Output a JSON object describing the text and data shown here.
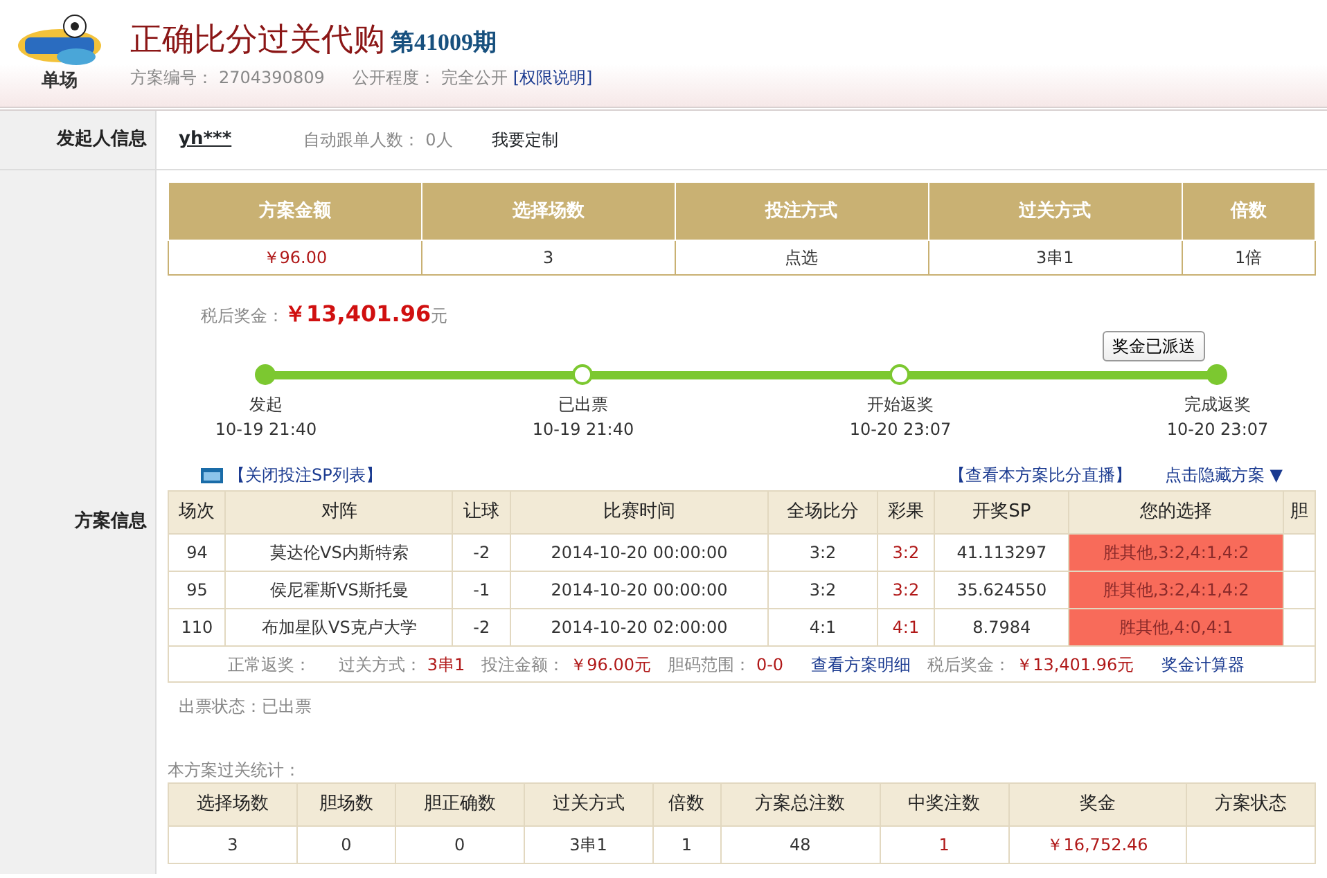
{
  "header": {
    "logo_caption": "单场",
    "title": "正确比分过关代购",
    "issue": "第41009期",
    "plan_no_label": "方案编号：",
    "plan_no": "2704390809",
    "public_label": "公开程度：",
    "public_value": "完全公开",
    "permission_link": "[权限说明]"
  },
  "initiator": {
    "label": "发起人信息",
    "user": "yh***",
    "follow_label": "自动跟单人数：",
    "follow_value": "0人",
    "custom_link": "我要定制"
  },
  "plan": {
    "label": "方案信息",
    "summary": {
      "columns": [
        "方案金额",
        "选择场数",
        "投注方式",
        "过关方式",
        "倍数"
      ],
      "cells": [
        {
          "text": "￥96.00",
          "kind": "money"
        },
        {
          "text": "3",
          "kind": "plain"
        },
        {
          "text": "点选",
          "kind": "plain"
        },
        {
          "text": "3串1",
          "kind": "plain"
        },
        {
          "text": "1倍",
          "kind": "plain"
        }
      ]
    },
    "prize": {
      "label": "税后奖金：",
      "amount": "￥13,401.96",
      "unit": "元"
    },
    "dispatch_button": "奖金已派送",
    "steps": [
      {
        "label": "发起",
        "time": "10-19 21:40",
        "reached": true
      },
      {
        "label": "已出票",
        "time": "10-19 21:40",
        "reached": false
      },
      {
        "label": "开始返奖",
        "time": "10-20 23:07",
        "reached": false
      },
      {
        "label": "完成返奖",
        "time": "10-20 23:07",
        "reached": true
      }
    ],
    "sp_toggle": "【关闭投注SP列表】",
    "live_link": "【查看本方案比分直播】",
    "hide_link": "点击隐藏方案",
    "hide_arrow": "▼",
    "matches": {
      "columns": [
        "场次",
        "对阵",
        "让球",
        "比赛时间",
        "全场比分",
        "彩果",
        "开奖SP",
        "您的选择",
        "胆"
      ],
      "rows": [
        {
          "no": "94",
          "match": "莫达伦VS内斯特索",
          "handicap": "-2",
          "time": "2014-10-20 00:00:00",
          "score": "3:2",
          "result": "3:2",
          "sp": "41.113297",
          "choice": "胜其他,3:2,4:1,4:2",
          "won": true
        },
        {
          "no": "95",
          "match": "侯尼霍斯VS斯托曼",
          "handicap": "-1",
          "time": "2014-10-20 00:00:00",
          "score": "3:2",
          "result": "3:2",
          "sp": "35.624550",
          "choice": "胜其他,3:2,4:1,4:2",
          "won": true
        },
        {
          "no": "110",
          "match": "布加星队VS克卢大学",
          "handicap": "-2",
          "time": "2014-10-20 02:00:00",
          "score": "4:1",
          "result": "4:1",
          "sp": "8.7984",
          "choice": "胜其他,4:0,4:1",
          "won": true
        }
      ],
      "footer": [
        {
          "text": "正常返奖：",
          "kind": "label"
        },
        {
          "text": "过关方式：",
          "kind": "label"
        },
        {
          "text": "3串1",
          "kind": "value"
        },
        {
          "text": "投注金额：",
          "kind": "label"
        },
        {
          "text": "￥96.00元",
          "kind": "value"
        },
        {
          "text": "胆码范围：",
          "kind": "label"
        },
        {
          "text": "0-0",
          "kind": "value"
        },
        {
          "text": "查看方案明细",
          "kind": "link"
        },
        {
          "text": "税后奖金：",
          "kind": "label"
        },
        {
          "text": "￥13,401.96元",
          "kind": "value"
        },
        {
          "text": "奖金计算器",
          "kind": "link"
        }
      ]
    },
    "ticket_status": "出票状态：已出票",
    "stats": {
      "title": "本方案过关统计：",
      "columns": [
        "选择场数",
        "胆场数",
        "胆正确数",
        "过关方式",
        "倍数",
        "方案总注数",
        "中奖注数",
        "奖金",
        "方案状态"
      ],
      "cells": [
        {
          "text": "3",
          "kind": "plain"
        },
        {
          "text": "0",
          "kind": "plain"
        },
        {
          "text": "0",
          "kind": "plain"
        },
        {
          "text": "3串1",
          "kind": "plain"
        },
        {
          "text": "1",
          "kind": "plain"
        },
        {
          "text": "48",
          "kind": "plain"
        },
        {
          "text": "1",
          "kind": "money"
        },
        {
          "text": "￥16,752.46",
          "kind": "money"
        }
      ]
    }
  }
}
